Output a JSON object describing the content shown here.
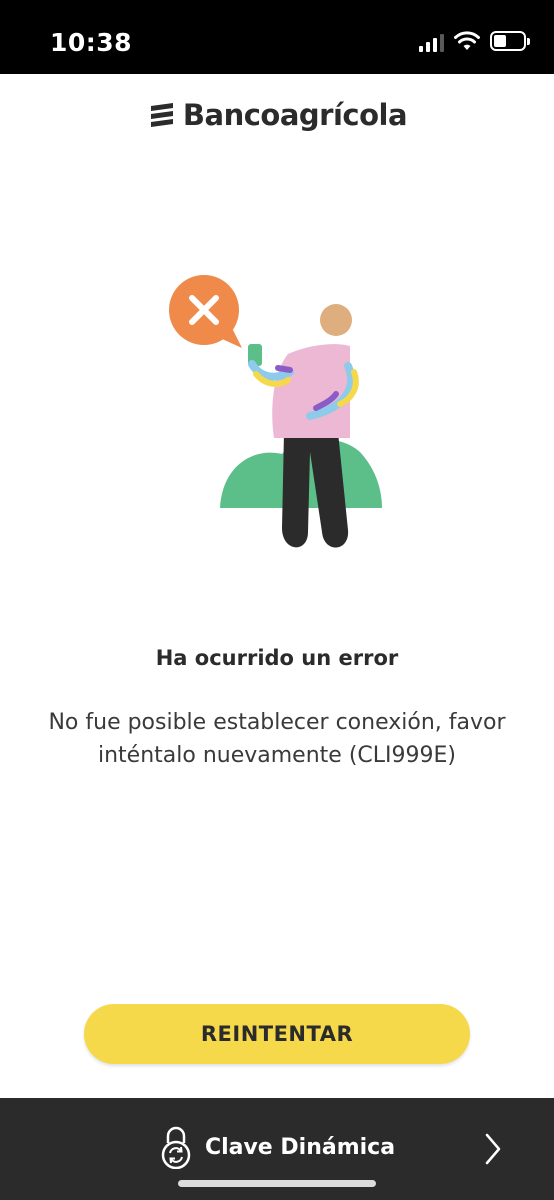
{
  "status_bar": {
    "time": "10:38"
  },
  "header": {
    "logo_text": "Bancoagrícola"
  },
  "error": {
    "title": "Ha ocurrido un error",
    "message": "No fue posible establecer conexión, favor inténtalo nuevamente (CLI999E)"
  },
  "actions": {
    "retry_label": "REINTENTAR"
  },
  "bottom_bar": {
    "label": "Clave Dinámica",
    "icon": "lock-refresh-icon"
  },
  "colors": {
    "accent_yellow": "#f5d94a",
    "bottom_bar": "#2b2b2b",
    "error_bubble": "#ef8a4b",
    "hill_green": "#5cbf8a",
    "shirt_pink": "#ecb8d3"
  }
}
